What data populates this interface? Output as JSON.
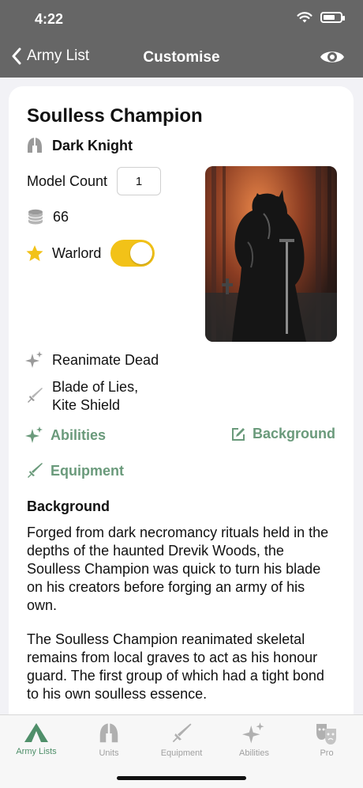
{
  "status": {
    "time": "4:22"
  },
  "nav": {
    "back_label": "Army List",
    "title": "Customise"
  },
  "unit": {
    "name": "Soulless Champion",
    "type": "Dark Knight",
    "model_count_label": "Model Count",
    "model_count": "1",
    "points": "66",
    "warlord_label": "Warlord",
    "warlord_on": true,
    "ability": "Reanimate Dead",
    "equipment_line1": "Blade of Lies,",
    "equipment_line2": "Kite Shield"
  },
  "links": {
    "abilities": "Abilities",
    "background": "Background",
    "equipment": "Equipment"
  },
  "background": {
    "heading": "Background",
    "p1": "Forged from dark necromancy rituals held in the depths of the haunted Drevik Woods, the Soulless Champion was quick to turn his blade on his creators before forging an army of his own.",
    "p2": "The Soulless Champion reanimated skeletal remains from local graves to act as his honour guard. The first group of which had a tight bond to his own soulless essence."
  },
  "tabs": [
    {
      "label": "Army Lists",
      "icon": "tent-icon",
      "active": true
    },
    {
      "label": "Units",
      "icon": "helmet-icon",
      "active": false
    },
    {
      "label": "Equipment",
      "icon": "sword-icon",
      "active": false
    },
    {
      "label": "Abilities",
      "icon": "sparkles-icon",
      "active": false
    },
    {
      "label": "Pro",
      "icon": "theater-masks-icon",
      "active": false
    }
  ],
  "colors": {
    "accent": "#6a9a7b",
    "toggle": "#f2c218",
    "nav_bg": "#666666"
  }
}
